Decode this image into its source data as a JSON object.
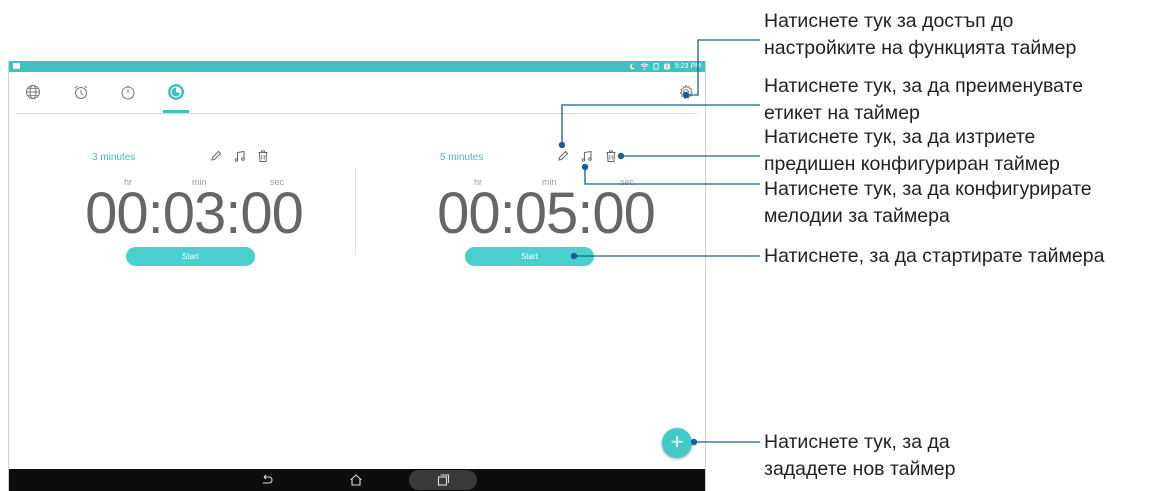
{
  "status_bar": {
    "time": "5:23 PM"
  },
  "toolbar": {
    "tabs": [
      {
        "name": "world-clock",
        "icon": "globe-icon"
      },
      {
        "name": "alarm",
        "icon": "alarm-clock-icon"
      },
      {
        "name": "stopwatch",
        "icon": "stopwatch-icon"
      },
      {
        "name": "timer",
        "icon": "timer-icon",
        "active": true
      }
    ],
    "settings_icon": "gear-icon"
  },
  "timers": [
    {
      "label": "3 minutes",
      "units": [
        "hr",
        "min",
        "sec"
      ],
      "time": "00:03:00",
      "start_label": "Start"
    },
    {
      "label": "5 minutes",
      "units": [
        "hr",
        "min",
        "sec"
      ],
      "time": "00:05:00",
      "start_label": "Start"
    }
  ],
  "fab": {
    "symbol": "+"
  },
  "callouts": {
    "settings": [
      "Натиснете тук за достъп до",
      "настройките на функцията таймер"
    ],
    "rename": [
      "Натиснете тук, за да преименувате",
      "етикет на таймер"
    ],
    "delete": [
      "Натиснете тук, за да изтриете",
      "предишен конфигуриран таймер"
    ],
    "ringtone": [
      "Натиснете тук, за да конфигурирате",
      "мелодии за таймера"
    ],
    "start": [
      "Натиснете, за да стартирате таймера"
    ],
    "add": [
      "Натиснете тук, за да",
      "зададете нов таймер"
    ]
  },
  "colors": {
    "accent": "#41c1bf",
    "button": "#4bcfcf",
    "digits": "#666666",
    "callout_line": "#1a5d99",
    "navbar": "#0d0d0d"
  }
}
